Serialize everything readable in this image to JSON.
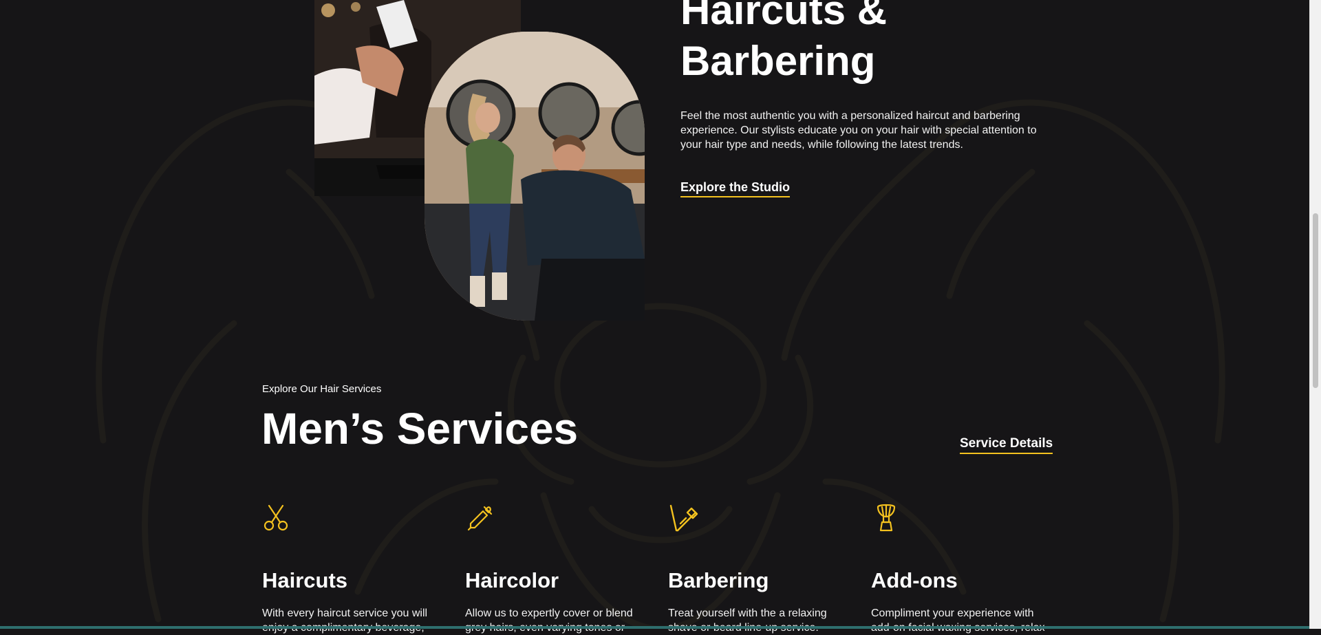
{
  "hero": {
    "title_line1": "Haircuts &",
    "title_line2": "Barbering",
    "description": "Feel the most authentic you with a personalized haircut and barbering experience. Our stylists educate you on your hair with special attention to your hair type and needs, while following the latest trends.",
    "cta_label": "Explore the Studio"
  },
  "services_section": {
    "eyebrow": "Explore Our Hair Services",
    "title": "Men’s Services",
    "details_link": "Service Details",
    "items": [
      {
        "icon": "scissors-icon",
        "title": "Haircuts",
        "description": "With every haircut service you will enjoy a complimentary beverage,"
      },
      {
        "icon": "dropper-icon",
        "title": "Haircolor",
        "description": "Allow us to expertly cover or blend grey hairs, even varying tones or"
      },
      {
        "icon": "razor-icon",
        "title": "Barbering",
        "description": "Treat yourself with the a relaxing shave or beard line-up service."
      },
      {
        "icon": "shaving-brush-icon",
        "title": "Add-ons",
        "description": "Compliment your experience with add-on facial waxing services, relax"
      }
    ]
  },
  "colors": {
    "background": "#161517",
    "accent": "#f4c21f",
    "text": "#ffffff"
  }
}
